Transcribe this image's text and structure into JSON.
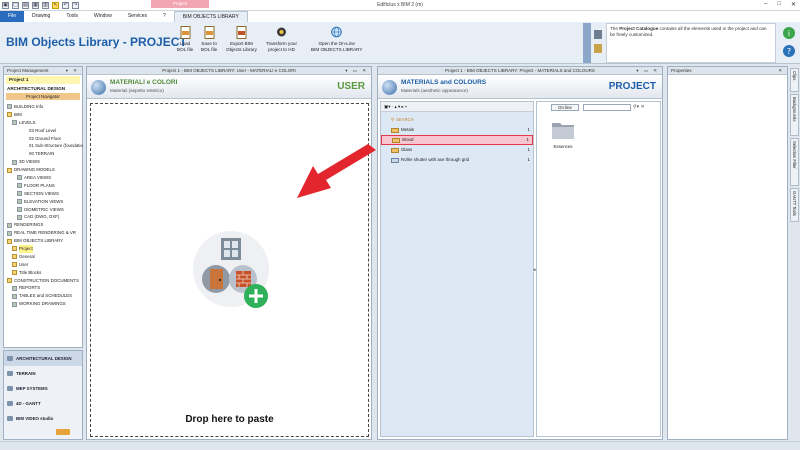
{
  "app": {
    "title": "Edificius x BIM 2 (m)"
  },
  "context_group": "Project",
  "menu": {
    "file": "File",
    "items": [
      "Drawing",
      "Tools",
      "Window",
      "Services",
      "?"
    ],
    "active_tab": "BIM OBJECTS LIBRARY"
  },
  "ribbon": {
    "title": "BIM Objects Library - PROJECT",
    "buttons": [
      {
        "label1": "Load",
        "label2": "BOL file",
        "icon": "load-bol-icon"
      },
      {
        "label1": "Save to",
        "label2": "BOL file",
        "icon": "save-bol-icon"
      },
      {
        "label1": "Export BIM",
        "label2": "Objects Library",
        "icon": "export-bim-icon"
      },
      {
        "label1": "Transform your",
        "label2": "project to HD",
        "icon": "transform-hd-icon"
      },
      {
        "label1": "Open the On-Line",
        "label2": "BIM OBJECTS LIBRARY",
        "icon": "globe-icon"
      }
    ],
    "info_bold": "Project Catalogue",
    "info_pre": "The ",
    "info_rest": " contains all the elements used in the project and can be freely customized."
  },
  "left_panel": {
    "header": "Project Management",
    "project": "Project 1",
    "section": "ARCHITECTURAL DESIGN",
    "navigator": "Project Navigator",
    "tree": [
      {
        "label": "BUILDING Info",
        "indent": 0,
        "icon": "g"
      },
      {
        "label": "BIM",
        "indent": 0,
        "icon": "y"
      },
      {
        "label": "LEVELS",
        "indent": 1,
        "icon": "g"
      },
      {
        "label": "03 Roof Level",
        "indent": 3,
        "icon": ""
      },
      {
        "label": "02 Ground Floor",
        "indent": 3,
        "icon": ""
      },
      {
        "label": "01 Sub-Structure (foundatio",
        "indent": 3,
        "icon": ""
      },
      {
        "label": "00 TERRAIN",
        "indent": 3,
        "icon": ""
      },
      {
        "label": "3D VIEWS",
        "indent": 1,
        "icon": "g"
      },
      {
        "label": "DRAWING MODELS",
        "indent": 0,
        "icon": "y"
      },
      {
        "label": "AREA VIEWS",
        "indent": 2,
        "icon": "g"
      },
      {
        "label": "FLOOR PLANS",
        "indent": 2,
        "icon": "g"
      },
      {
        "label": "SECTION VIEWS",
        "indent": 2,
        "icon": "g"
      },
      {
        "label": "ELEVATION VIEWS",
        "indent": 2,
        "icon": "g"
      },
      {
        "label": "ISOMETRIC VIEWS",
        "indent": 2,
        "icon": "g"
      },
      {
        "label": "CAD (DWG, DXF)",
        "indent": 2,
        "icon": "g"
      },
      {
        "label": "RENDERINGS",
        "indent": 0,
        "icon": "g"
      },
      {
        "label": "REAL TIME RENDERING & VR",
        "indent": 0,
        "icon": "g"
      },
      {
        "label": "BIM OBJECTS LIBRARY",
        "indent": 0,
        "icon": "y"
      },
      {
        "label": "Project",
        "indent": 1,
        "icon": "y",
        "selected": true
      },
      {
        "label": "General",
        "indent": 1,
        "icon": "y"
      },
      {
        "label": "User",
        "indent": 1,
        "icon": "y"
      },
      {
        "label": "Title Blocks",
        "indent": 1,
        "icon": "y"
      },
      {
        "label": "CONSTRUCTION DOCUMENTS",
        "indent": 0,
        "icon": "y"
      },
      {
        "label": "REPORTS",
        "indent": 1,
        "icon": "g"
      },
      {
        "label": "TABLES and SCHEDULES",
        "indent": 1,
        "icon": "g"
      },
      {
        "label": "WORKING DRAWINGS",
        "indent": 1,
        "icon": "g"
      }
    ],
    "nav": [
      "ARCHITECTURAL DESIGN",
      "TERRAIN",
      "MEP SYSTEMS",
      "4D - GANTT",
      "BIM VIDEO studio"
    ]
  },
  "user_panel": {
    "header": "Project 1 - BIM OBJECTS LIBRARY: User - MATERIALI e COLORI",
    "title": "MATERIALI e COLORI",
    "subtitle": "Materiali (aspetto estetico)",
    "tag": "USER",
    "drop_text": "Drop here to paste"
  },
  "project_panel": {
    "header": "Project 1 - BIM OBJECTS LIBRARY: Project - MATERIALS and COLOURS",
    "title": "MATERIALS and COLOURS",
    "subtitle": "Materials (aesthetic appearance)",
    "tag": "PROJECT",
    "search_label": "SEARCH",
    "online_label": "On line",
    "items": [
      {
        "label": "Metals",
        "count": "1"
      },
      {
        "label": "Wood",
        "count": "1",
        "highlighted": true
      },
      {
        "label": "Glass",
        "count": "1"
      },
      {
        "label": "Roller shutter with axe through grid",
        "count": "1"
      }
    ],
    "folder_label": "Essences"
  },
  "properties": {
    "header": "Properties"
  },
  "side_tabs": [
    "Clips",
    "Backgrounds",
    "Selection Filter",
    "GANTT Tools"
  ],
  "colors": {
    "accent_blue": "#1d5ea8",
    "user_green": "#5c9a3e",
    "arrow_red": "#e3262d",
    "highlight_red": "#e4394d",
    "add_green": "#2fb05a"
  }
}
